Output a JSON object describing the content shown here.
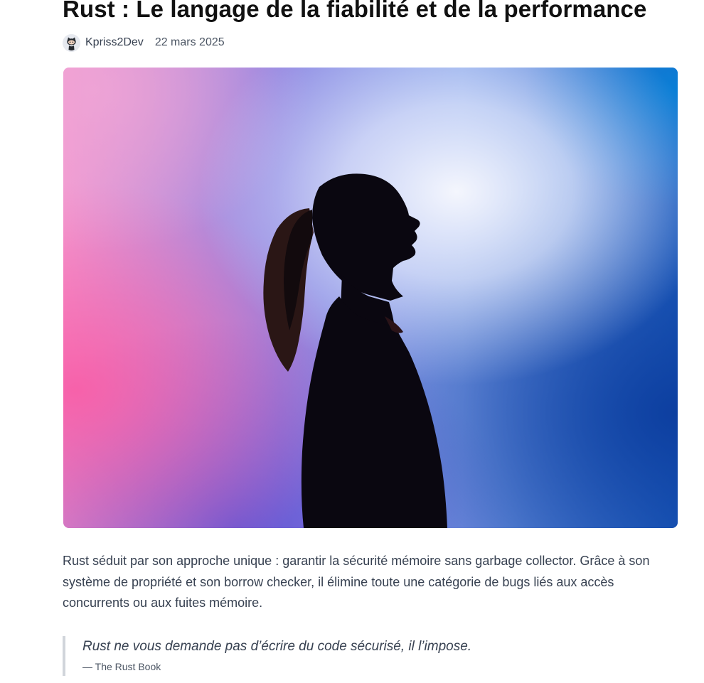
{
  "article": {
    "title": "Rust : Le langage de la fiabilité et de la performance",
    "author": "Kpriss2Dev",
    "date": "22 mars 2025",
    "avatar_icon": "octocat-avatar-icon",
    "hero_image": "silhouette-gradient-photo",
    "intro": "Rust séduit par son approche unique : garantir la sécurité mémoire sans garbage collector. Grâce à son système de propriété et son borrow checker, il élimine toute une catégorie de bugs liés aux accès concurrents ou aux fuites mémoire.",
    "quote": {
      "text": "Rust ne vous demande pas d’écrire du code sécurisé, il l’impose.",
      "cite": "— The Rust Book"
    }
  },
  "colors": {
    "title": "#111111",
    "body_text": "#374151",
    "quote_border": "#d1d5db",
    "gradient_pink": "#f39ad0",
    "gradient_violet": "#8a7fe0",
    "gradient_blue": "#1a5fc0",
    "gradient_light": "#eef2fb"
  }
}
